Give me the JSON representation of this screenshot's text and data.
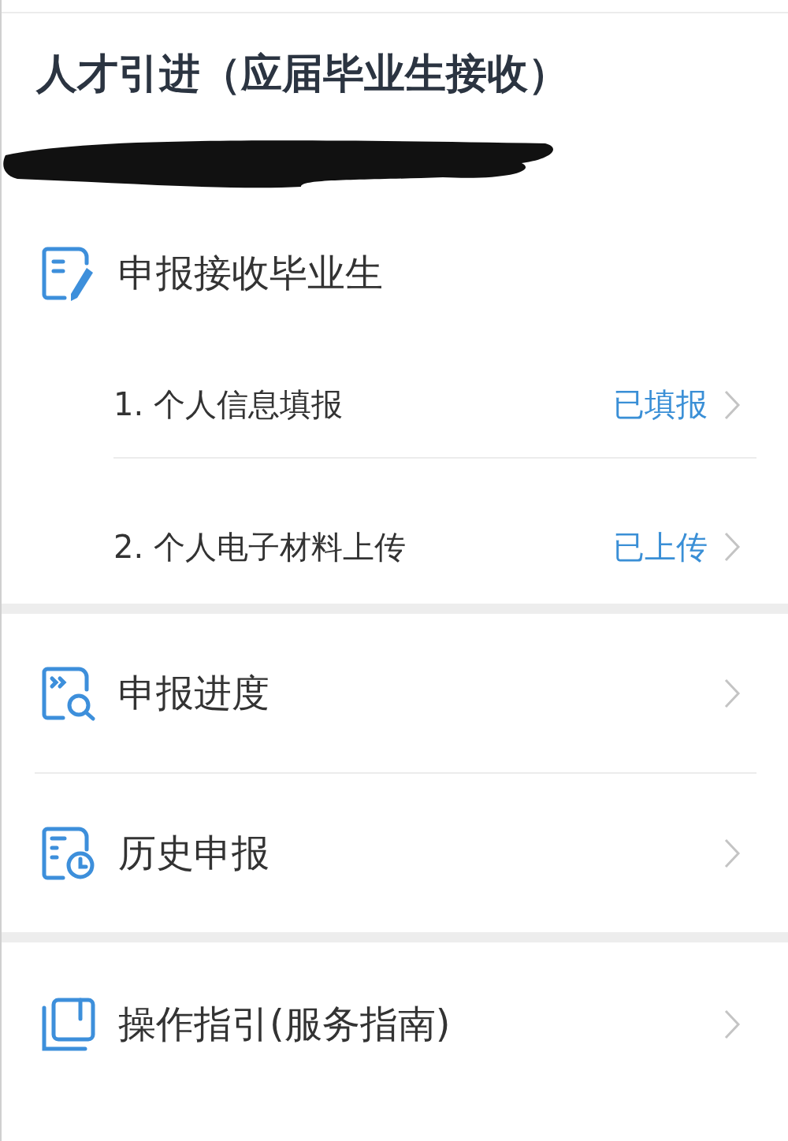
{
  "title": "人才引进（应届毕业生接收）",
  "apply": {
    "label": "申报接收毕业生",
    "steps": [
      {
        "label": "1. 个人信息填报",
        "status": "已填报"
      },
      {
        "label": "2. 个人电子材料上传",
        "status": "已上传"
      }
    ]
  },
  "menu_groups": [
    {
      "items": [
        {
          "label": "申报进度"
        },
        {
          "label": "历史申报"
        }
      ]
    },
    {
      "items": [
        {
          "label": "操作指引(服务指南)"
        }
      ]
    }
  ]
}
